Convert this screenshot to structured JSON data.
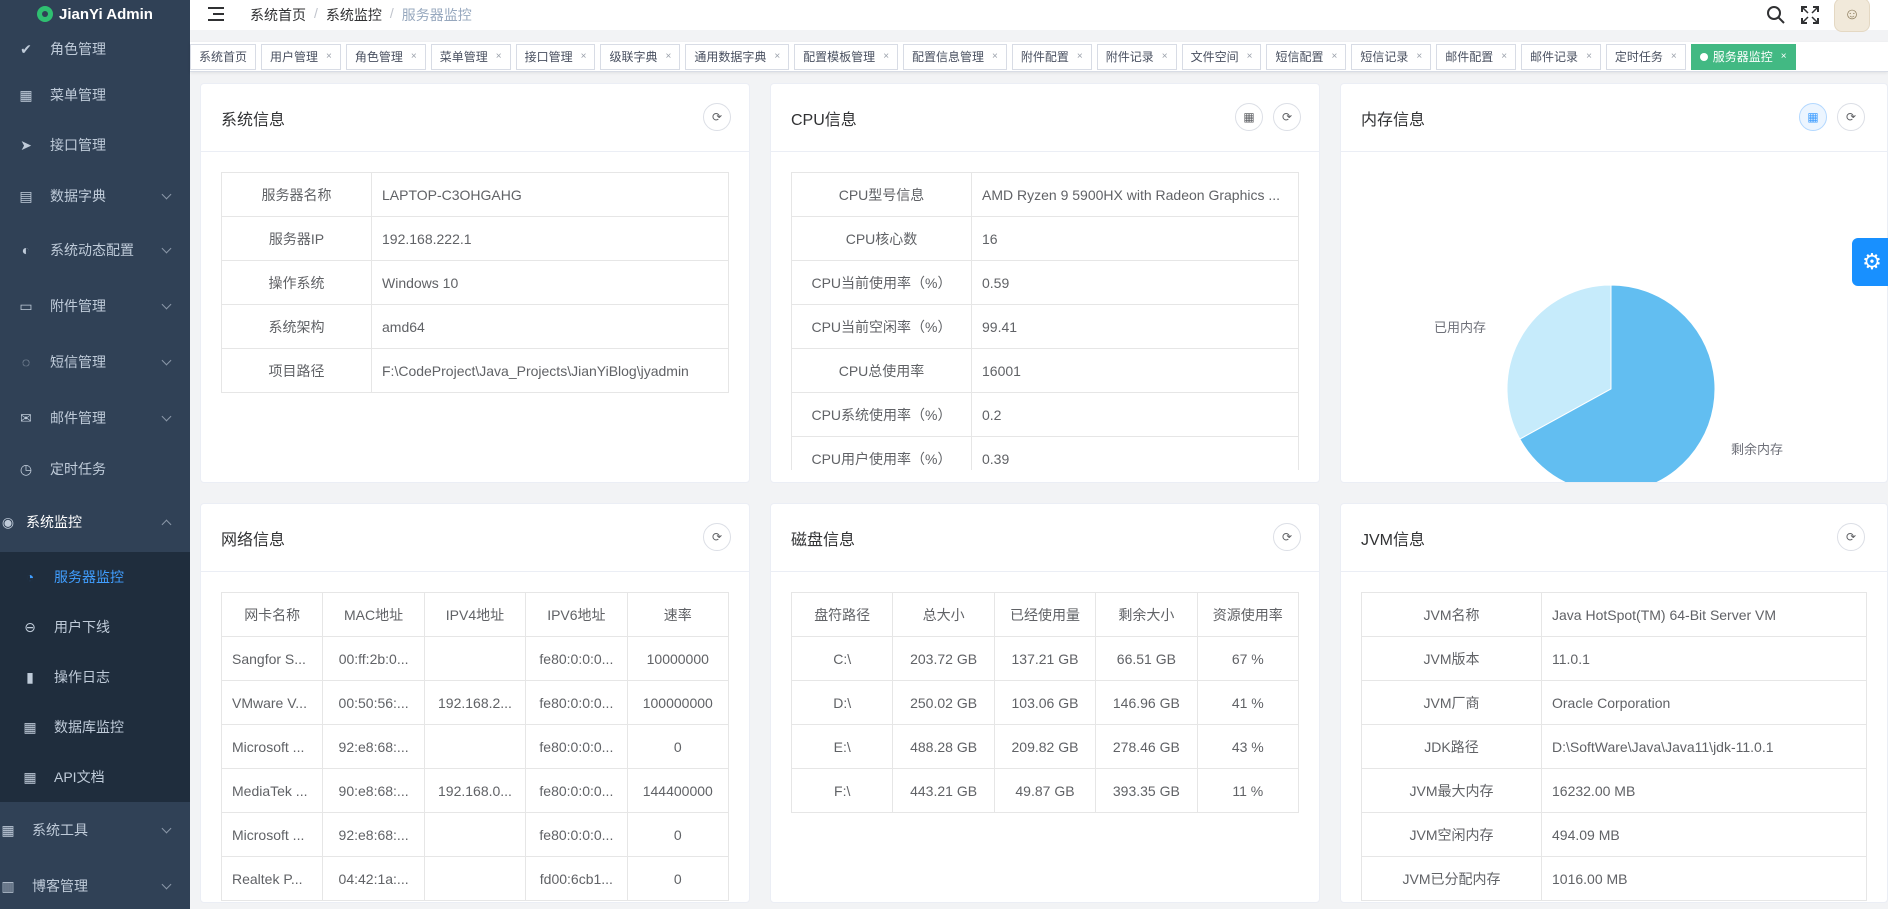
{
  "app": {
    "title": "JianYi Admin"
  },
  "sidebar": {
    "items": [
      {
        "label": "角色管理",
        "icon": "check-circle-icon",
        "expandable": false
      },
      {
        "label": "菜单管理",
        "icon": "grid-icon",
        "expandable": false
      },
      {
        "label": "接口管理",
        "icon": "send-icon",
        "expandable": false
      },
      {
        "label": "数据字典",
        "icon": "clipboard-icon",
        "expandable": true
      },
      {
        "label": "系统动态配置",
        "icon": "toggle-icon",
        "expandable": true
      },
      {
        "label": "附件管理",
        "icon": "folder-icon",
        "expandable": true
      },
      {
        "label": "短信管理",
        "icon": "chat-icon",
        "expandable": true
      },
      {
        "label": "邮件管理",
        "icon": "mail-icon",
        "expandable": true
      },
      {
        "label": "定时任务",
        "icon": "clock-icon",
        "expandable": false
      }
    ],
    "open_group": {
      "label": "系统监控",
      "icon": "camera-icon",
      "children": [
        {
          "label": "服务器监控",
          "icon": "dashboard-icon",
          "active": true
        },
        {
          "label": "用户下线",
          "icon": "minus-circle-icon",
          "active": false
        },
        {
          "label": "操作日志",
          "icon": "bar-chart-icon",
          "active": false
        },
        {
          "label": "数据库监控",
          "icon": "grid-icon",
          "active": false
        },
        {
          "label": "API文档",
          "icon": "grid-icon",
          "active": false
        }
      ]
    },
    "after_items": [
      {
        "label": "系统工具",
        "icon": "apps-icon",
        "expandable": true
      },
      {
        "label": "博客管理",
        "icon": "book-icon",
        "expandable": true
      }
    ]
  },
  "header": {
    "breadcrumb": [
      "系统首页",
      "系统监控",
      "服务器监控"
    ]
  },
  "tags": [
    {
      "label": "系统首页",
      "closable": false,
      "active": false
    },
    {
      "label": "用户管理",
      "closable": true,
      "active": false
    },
    {
      "label": "角色管理",
      "closable": true,
      "active": false
    },
    {
      "label": "菜单管理",
      "closable": true,
      "active": false
    },
    {
      "label": "接口管理",
      "closable": true,
      "active": false
    },
    {
      "label": "级联字典",
      "closable": true,
      "active": false
    },
    {
      "label": "通用数据字典",
      "closable": true,
      "active": false
    },
    {
      "label": "配置模板管理",
      "closable": true,
      "active": false
    },
    {
      "label": "配置信息管理",
      "closable": true,
      "active": false
    },
    {
      "label": "附件配置",
      "closable": true,
      "active": false
    },
    {
      "label": "附件记录",
      "closable": true,
      "active": false
    },
    {
      "label": "文件空间",
      "closable": true,
      "active": false
    },
    {
      "label": "短信配置",
      "closable": true,
      "active": false
    },
    {
      "label": "短信记录",
      "closable": true,
      "active": false
    },
    {
      "label": "邮件配置",
      "closable": true,
      "active": false
    },
    {
      "label": "邮件记录",
      "closable": true,
      "active": false
    },
    {
      "label": "定时任务",
      "closable": true,
      "active": false
    },
    {
      "label": "服务器监控",
      "closable": true,
      "active": true
    }
  ],
  "system_info": {
    "title": "系统信息",
    "rows": [
      {
        "k": "服务器名称",
        "v": "LAPTOP-C3OHGAHG"
      },
      {
        "k": "服务器IP",
        "v": "192.168.222.1"
      },
      {
        "k": "操作系统",
        "v": "Windows 10"
      },
      {
        "k": "系统架构",
        "v": "amd64"
      },
      {
        "k": "项目路径",
        "v": "F:\\CodeProject\\Java_Projects\\JianYiBlog\\jyadmin"
      }
    ]
  },
  "cpu_info": {
    "title": "CPU信息",
    "rows": [
      {
        "k": "CPU型号信息",
        "v": "AMD Ryzen 9 5900HX with Radeon Graphics ..."
      },
      {
        "k": "CPU核心数",
        "v": "16"
      },
      {
        "k": "CPU当前使用率（%）",
        "v": "0.59"
      },
      {
        "k": "CPU当前空闲率（%）",
        "v": "99.41"
      },
      {
        "k": "CPU总使用率",
        "v": "16001"
      },
      {
        "k": "CPU系统使用率（%）",
        "v": "0.2"
      },
      {
        "k": "CPU用户使用率（%）",
        "v": "0.39"
      }
    ]
  },
  "memory_info": {
    "title": "内存信息",
    "legend": [
      "已用内存",
      "剩余内存"
    ]
  },
  "chart_data": {
    "type": "pie",
    "title": "",
    "categories": [
      "已用内存",
      "剩余内存"
    ],
    "values": [
      33,
      67
    ],
    "colors": [
      "#c6ebfb",
      "#62bef1"
    ]
  },
  "network_info": {
    "title": "网络信息",
    "columns": [
      "网卡名称",
      "MAC地址",
      "IPV4地址",
      "IPV6地址",
      "速率"
    ],
    "rows": [
      [
        "Sangfor S...",
        "00:ff:2b:0...",
        "",
        "fe80:0:0:0...",
        "10000000"
      ],
      [
        "VMware V...",
        "00:50:56:...",
        "192.168.2...",
        "fe80:0:0:0...",
        "100000000"
      ],
      [
        "Microsoft ...",
        "92:e8:68:...",
        "",
        "fe80:0:0:0...",
        "0"
      ],
      [
        "MediaTek ...",
        "90:e8:68:...",
        "192.168.0...",
        "fe80:0:0:0...",
        "144400000"
      ],
      [
        "Microsoft ...",
        "92:e8:68:...",
        "",
        "fe80:0:0:0...",
        "0"
      ],
      [
        "Realtek P...",
        "04:42:1a:...",
        "",
        "fd00:6cb1...",
        "0"
      ]
    ]
  },
  "disk_info": {
    "title": "磁盘信息",
    "columns": [
      "盘符路径",
      "总大小",
      "已经使用量",
      "剩余大小",
      "资源使用率"
    ],
    "rows": [
      [
        "C:\\",
        "203.72 GB",
        "137.21 GB",
        "66.51 GB",
        "67 %"
      ],
      [
        "D:\\",
        "250.02 GB",
        "103.06 GB",
        "146.96 GB",
        "41 %"
      ],
      [
        "E:\\",
        "488.28 GB",
        "209.82 GB",
        "278.46 GB",
        "43 %"
      ],
      [
        "F:\\",
        "443.21 GB",
        "49.87 GB",
        "393.35 GB",
        "11 %"
      ]
    ]
  },
  "jvm_info": {
    "title": "JVM信息",
    "rows": [
      {
        "k": "JVM名称",
        "v": "Java HotSpot(TM) 64-Bit Server VM"
      },
      {
        "k": "JVM版本",
        "v": "11.0.1"
      },
      {
        "k": "JVM厂商",
        "v": "Oracle Corporation"
      },
      {
        "k": "JDK路径",
        "v": "D:\\SoftWare\\Java\\Java11\\jdk-11.0.1"
      },
      {
        "k": "JVM最大内存",
        "v": "16232.00 MB"
      },
      {
        "k": "JVM空闲内存",
        "v": "494.09 MB"
      },
      {
        "k": "JVM已分配内存",
        "v": "1016.00 MB"
      }
    ]
  },
  "colors": {
    "sidebar_bg": "#304156",
    "submenu_bg": "#1f2d3d",
    "accent": "#409eff",
    "active_tag": "#42b983"
  }
}
